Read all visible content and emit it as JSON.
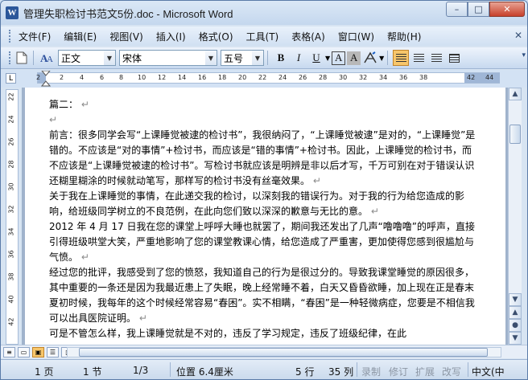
{
  "window": {
    "title": "管理失职检讨书范文5份.doc - Microsoft Word",
    "app_icon": "W",
    "controls": {
      "minimize": "–",
      "maximize": "□",
      "close": "✕"
    }
  },
  "menu": {
    "items": [
      "文件(F)",
      "编辑(E)",
      "视图(V)",
      "插入(I)",
      "格式(O)",
      "工具(T)",
      "表格(A)",
      "窗口(W)",
      "帮助(H)"
    ],
    "close_doc": "✕"
  },
  "toolbar": {
    "style_value": "正文",
    "font_value": "宋体",
    "size_value": "五号",
    "bold": "B",
    "italic": "I",
    "underline": "U",
    "char_border": "A",
    "char_shade": "A",
    "highlight": "A",
    "icons": [
      "new-doc-icon",
      "styles-icon",
      "bold-icon",
      "italic-icon",
      "underline-icon",
      "char-border-icon",
      "char-shading-icon",
      "highlight-icon",
      "align-justify-icon",
      "align-center-icon",
      "align-right-icon",
      "distribute-icon"
    ]
  },
  "ruler": {
    "corner": "L",
    "labels": [
      "2",
      "2",
      "4",
      "6",
      "8",
      "10",
      "12",
      "14",
      "16",
      "18",
      "20",
      "22",
      "24",
      "26",
      "28",
      "30",
      "32",
      "34",
      "36",
      "38",
      "42",
      "44"
    ],
    "vertical_labels": [
      "22",
      "24",
      "26",
      "28",
      "30",
      "32",
      "34",
      "36",
      "38",
      "40",
      "42"
    ]
  },
  "document": {
    "heading": "篇二：",
    "paragraphs": [
      "前言：很多同学会写“上课睡觉被逮的检讨书”，我很纳闷了，“上课睡觉被逮”是对的，“上课睡觉”是错的。不应该是“对的事情”+检讨书，而应该是“错的事情”+检讨书。因此，上课睡觉的检讨书，而不应该是“上课睡觉被逮的检讨书”。写检讨书就应该是明辨是非以后才写，千万可别在对于错误认识还糊里糊涂的时候就动笔写，那样写的检讨书没有丝毫效果。",
      "关于我在上课睡觉的事情，在此递交我的检讨，以深刻我的错误行为。对于我的行为给您造成的影响，给班级同学树立的不良范例，在此向您们致以深深的歉意与无比的意。",
      "2012 年 4 月 17 日我在您的课堂上呼呼大睡也就罢了，期间我还发出了几声“噜噜噜”的呼声，直接引得班级哄堂大笑，严重地影响了您的课堂教课心情，给您造成了严重害，更加使得您感到很尴尬与气愤。",
      "经过您的批评，我感受到了您的愤怒，我知道自己的行为是很过分的。导致我课堂睡觉的原因很多，其中重要的一条还是因为我最近患上了失眠，晚上经常睡不着，白天又昏昏欲睡，加上现在正是春末夏初时候，我每年的这个时候经常容易“春困”。实不相瞒，“春困”是一种轻微病症，您要是不相信我可以出具医院证明。",
      "可是不管怎么样，我上课睡觉就是不对的，违反了学习规定，违反了班级纪律，在此"
    ]
  },
  "status": {
    "page": "1 页",
    "section": "1 节",
    "page_of": "1/3",
    "position": "位置 6.4厘米",
    "line": "5 行",
    "col": "35 列",
    "rec": "录制",
    "trk": "修订",
    "ext": "扩展",
    "ovr": "改写",
    "lang": "中文(中"
  }
}
